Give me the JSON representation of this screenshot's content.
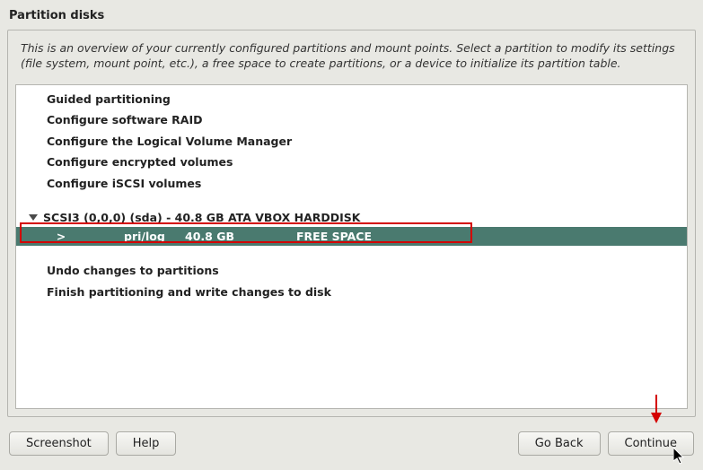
{
  "title": "Partition disks",
  "instructions": "This is an overview of your currently configured partitions and mount points. Select a partition to modify its settings (file system, mount point, etc.), a free space to create partitions, or a device to initialize its partition table.",
  "menu": {
    "guided": "Guided partitioning",
    "raid": "Configure software RAID",
    "lvm": "Configure the Logical Volume Manager",
    "encrypted": "Configure encrypted volumes",
    "iscsi": "Configure iSCSI volumes"
  },
  "disk": {
    "label": "SCSI3 (0,0,0) (sda) - 40.8 GB ATA VBOX HARDDISK",
    "partition": {
      "marker": ">",
      "type": "pri/log",
      "size": "40.8 GB",
      "usage": "FREE SPACE"
    }
  },
  "actions": {
    "undo": "Undo changes to partitions",
    "finish": "Finish partitioning and write changes to disk"
  },
  "buttons": {
    "screenshot": "Screenshot",
    "help": "Help",
    "goback": "Go Back",
    "continue": "Continue"
  }
}
